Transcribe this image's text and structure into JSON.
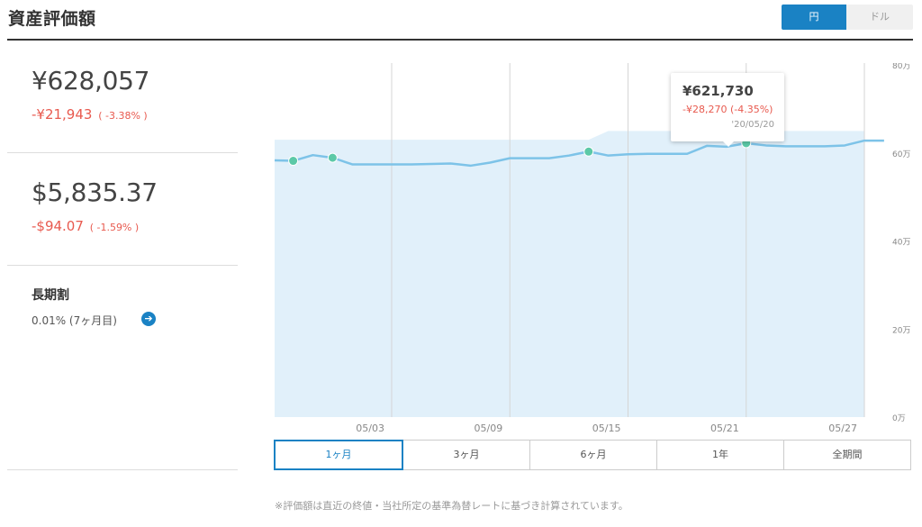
{
  "header": {
    "title": "資産評価額"
  },
  "currency_toggle": {
    "options": [
      "円",
      "ドル"
    ],
    "selected": "円",
    "active_color": "#1a82c4"
  },
  "summary": {
    "jpy": {
      "value": "¥628,057",
      "change": "-¥21,943",
      "change_pct": "( -3.38% )"
    },
    "usd": {
      "value": "$5,835.37",
      "change": "-$94.07",
      "change_pct": "( -1.59% )"
    },
    "long_term": {
      "title": "長期割",
      "value": "0.01% (7ヶ月目)",
      "link_icon": "arrow-right-icon"
    }
  },
  "tooltip": {
    "value": "¥621,730",
    "change": "-¥28,270 (-4.35%)",
    "date": "'20/05/20"
  },
  "period_tabs": [
    "1ヶ月",
    "3ヶ月",
    "6ヶ月",
    "1年",
    "全期間"
  ],
  "selected_period": "1ヶ月",
  "footnote": "※評価額は直近の終値・当社所定の基準為替レートに基づき計算されています。",
  "chart_data": {
    "type": "area",
    "x_ticks": [
      "05/03",
      "05/09",
      "05/15",
      "05/21",
      "05/27"
    ],
    "y_ticks": [
      "0万",
      "20万",
      "40万",
      "60万",
      "80万"
    ],
    "ylim": [
      0,
      80
    ],
    "y_unit": "万円",
    "series": [
      {
        "values": [
          {
            "x": "04/27",
            "y": 58.3
          },
          {
            "x": "04/28",
            "y": 58.2
          },
          {
            "x": "04/29",
            "y": 59.5
          },
          {
            "x": "04/30",
            "y": 58.9
          },
          {
            "x": "05/01",
            "y": 57.4
          },
          {
            "x": "05/04",
            "y": 57.4
          },
          {
            "x": "05/05",
            "y": 57.5
          },
          {
            "x": "05/06",
            "y": 57.6
          },
          {
            "x": "05/07",
            "y": 57.1
          },
          {
            "x": "05/08",
            "y": 57.8
          },
          {
            "x": "05/09",
            "y": 58.8
          },
          {
            "x": "05/10",
            "y": 58.8
          },
          {
            "x": "05/11",
            "y": 58.8
          },
          {
            "x": "05/12",
            "y": 59.4
          },
          {
            "x": "05/13",
            "y": 60.3
          },
          {
            "x": "05/14",
            "y": 59.4
          },
          {
            "x": "05/15",
            "y": 59.7
          },
          {
            "x": "05/16",
            "y": 59.8
          },
          {
            "x": "05/17",
            "y": 59.8
          },
          {
            "x": "05/18",
            "y": 59.8
          },
          {
            "x": "05/19",
            "y": 61.6
          },
          {
            "x": "05/20",
            "y": 61.4
          },
          {
            "x": "05/21",
            "y": 62.2
          },
          {
            "x": "05/22",
            "y": 61.7
          },
          {
            "x": "05/23",
            "y": 61.5
          },
          {
            "x": "05/24",
            "y": 61.5
          },
          {
            "x": "05/25",
            "y": 61.5
          },
          {
            "x": "05/26",
            "y": 61.7
          },
          {
            "x": "05/27",
            "y": 62.8
          },
          {
            "x": "05/28",
            "y": 62.8
          }
        ],
        "color": "#7dc3e8"
      }
    ],
    "deposit_area": {
      "values": [
        {
          "x": "04/27",
          "y": 63
        },
        {
          "x": "05/13",
          "y": 63
        },
        {
          "x": "05/14",
          "y": 65
        },
        {
          "x": "05/28",
          "y": 65
        }
      ],
      "color": "#e1f0fa"
    },
    "markers": [
      {
        "x": "04/28",
        "y": 58.2
      },
      {
        "x": "04/30",
        "y": 58.9
      },
      {
        "x": "05/13",
        "y": 60.3
      },
      {
        "x": "05/21",
        "y": 62.2
      }
    ],
    "marker_color": "#5cc9a7",
    "grid": true,
    "y_axis_position": "right"
  }
}
